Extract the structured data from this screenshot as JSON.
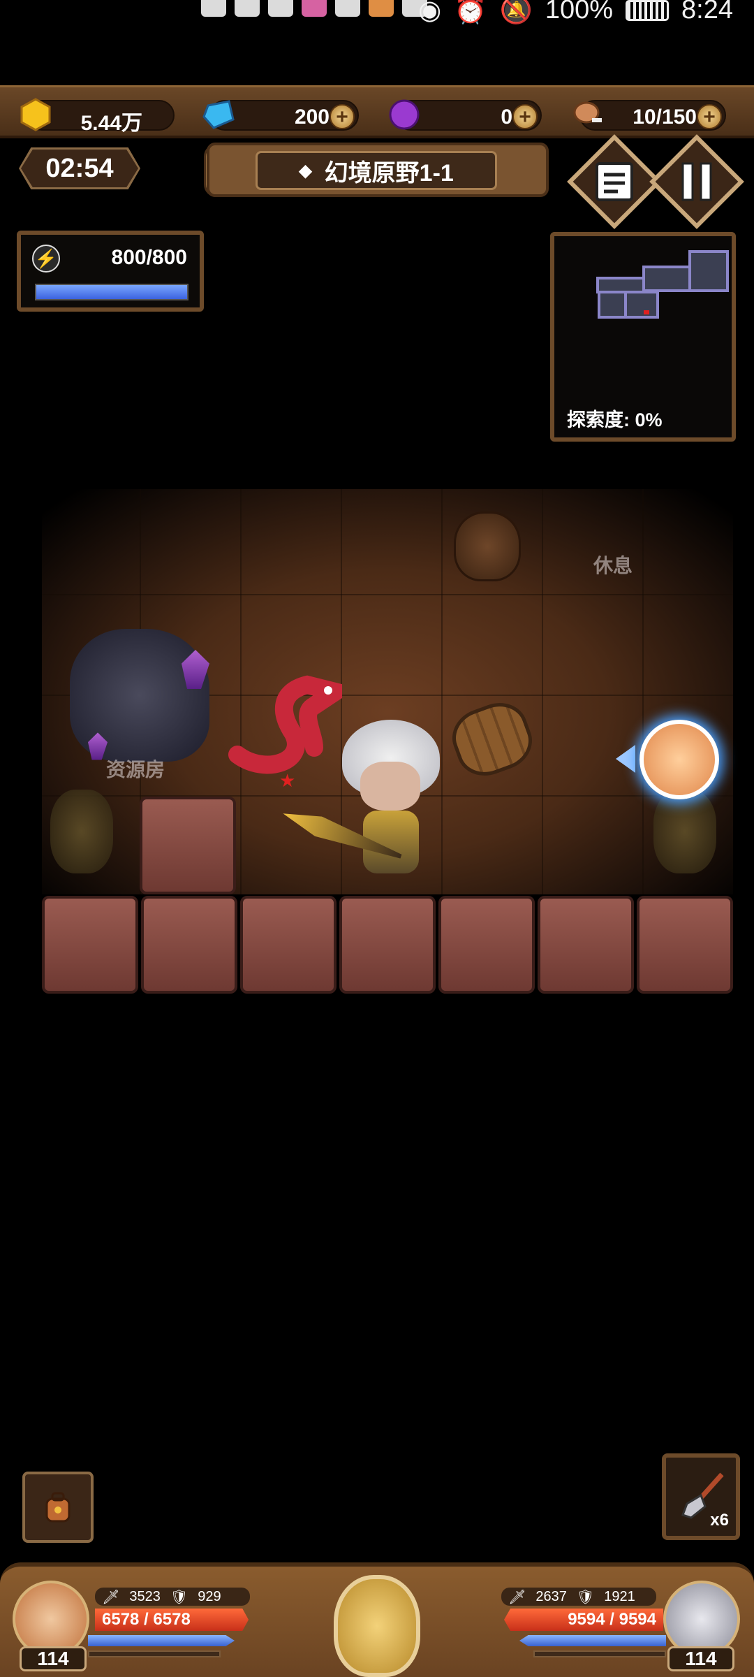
{
  "status_bar": {
    "battery": "100%",
    "time": "8:24"
  },
  "resources": [
    {
      "name": "gold",
      "icon": "gold-coin-icon",
      "value": "5.44万",
      "has_plus": false
    },
    {
      "name": "diamond",
      "icon": "diamond-icon",
      "value": "200",
      "has_plus": true
    },
    {
      "name": "essence",
      "icon": "purple-orb-icon",
      "value": "0",
      "has_plus": true
    },
    {
      "name": "stamina",
      "icon": "meat-icon",
      "value": "10/150",
      "has_plus": true
    }
  ],
  "plus_label": "+",
  "timer": "02:54",
  "stage": {
    "title": "幻境原野1-1",
    "icon": "stage-marker-icon"
  },
  "energy": {
    "label": "800/800",
    "fill_fraction": 1.0
  },
  "minimap": {
    "label": "探索度: 0%"
  },
  "dungeon": {
    "resource_room_label": "资源房",
    "rest_room_label": "休息"
  },
  "shovel": {
    "count": "x6"
  },
  "team": {
    "left": {
      "attack": "3523",
      "defense": "929",
      "hp": "6578 / 6578",
      "level": "114"
    },
    "right": {
      "attack": "2637",
      "defense": "1921",
      "hp": "9594 / 9594",
      "level": "114"
    }
  },
  "colors": {
    "wood": "#6a4727",
    "energy": "#3b62e0",
    "hp": "#c8301a",
    "minimap_room": "#8b86c9"
  }
}
